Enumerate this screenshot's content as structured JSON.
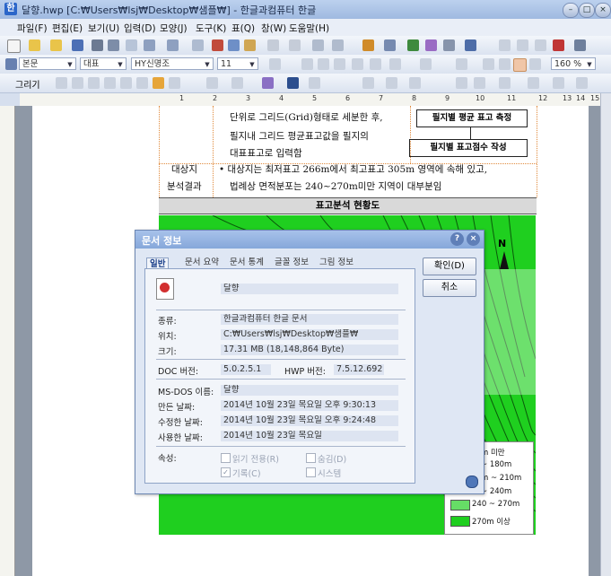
{
  "window": {
    "title": "달향.hwp [C:₩Users₩lsj₩Desktop₩샘플₩] - 한글과컴퓨터 한글",
    "app_icon": "document-icon"
  },
  "menu": [
    "파일(F)",
    "편집(E)",
    "보기(U)",
    "입력(D)",
    "모양(J)",
    "도구(K)",
    "표(Q)",
    "창(W)",
    "도움말(H)"
  ],
  "format_bar": {
    "style": "본문",
    "font_lang": "대표",
    "font_name": "HY신명조",
    "font_size": "11",
    "zoom": "160 %"
  },
  "draw_bar": {
    "label": "그리기"
  },
  "ruler_numbers": [
    "1",
    "2",
    "3",
    "4",
    "5",
    "6",
    "7",
    "8",
    "9",
    "10",
    "11",
    "12",
    "13",
    "14",
    "15"
  ],
  "document": {
    "body_lines": [
      "단위로 그리드(Grid)형태로 세분한 후,",
      "필지내 그리드 평균표고값을 필지의",
      "대표표고로 입력함"
    ],
    "flow_boxes": [
      "필지별 평균 표고 측정",
      "필지별 표고점수 작성"
    ],
    "row_header": [
      "대상지",
      "분석결과"
    ],
    "result_lines": [
      "• 대상지는 최저표고 266m에서 최고표고 305m 영역에 속해 있고,",
      "법례상 면적분포는 240~270m미만 지역이 대부분임"
    ],
    "section_title": "표고분석 현황도",
    "map_legend": [
      "m 미만",
      "~ 180m",
      "m ~ 210m",
      "~ 240m",
      "240 ~ 270m",
      "270m 이상"
    ],
    "north_label": "N"
  },
  "dialog": {
    "title": "문서 정보",
    "tabs": [
      "일반",
      "문서 요약",
      "문서 통계",
      "글꼴 정보",
      "그림 정보"
    ],
    "file_name": "달향",
    "fields": {
      "type_label": "종류:",
      "type_value": "한글과컴퓨터 한글 문서",
      "location_label": "위치:",
      "location_value": "C:₩Users₩lsj₩Desktop₩샘플₩",
      "size_label": "크기:",
      "size_value": "17.31 MB (18,148,864 Byte)",
      "doc_version_label": "DOC 버전:",
      "doc_version_value": "5.0.2.5.1",
      "hwp_version_label": "HWP 버전:",
      "hwp_version_value": "7.5.12.692",
      "msdos_label": "MS-DOS 이름:",
      "msdos_value": "달향",
      "created_label": "만든 날짜:",
      "created_value": "2014년 10월 23일 목요일 오후 9:30:13",
      "modified_label": "수정한 날짜:",
      "modified_value": "2014년 10월 23일 목요일 오후 9:24:48",
      "accessed_label": "사용한 날짜:",
      "accessed_value": "2014년 10월 23일 목요일"
    },
    "attributes_label": "속성:",
    "attributes": [
      {
        "label": "읽기 전용(R)",
        "checked": false
      },
      {
        "label": "숨김(D)",
        "checked": false
      },
      {
        "label": "기록(C)",
        "checked": true
      },
      {
        "label": "시스템",
        "checked": false
      }
    ],
    "ok_label": "확인(D)",
    "cancel_label": "취소"
  },
  "colors": {
    "map_green": "#1fcf1f",
    "dialog_bg": "#dfe7f4",
    "title_blue": "#86a7da"
  }
}
